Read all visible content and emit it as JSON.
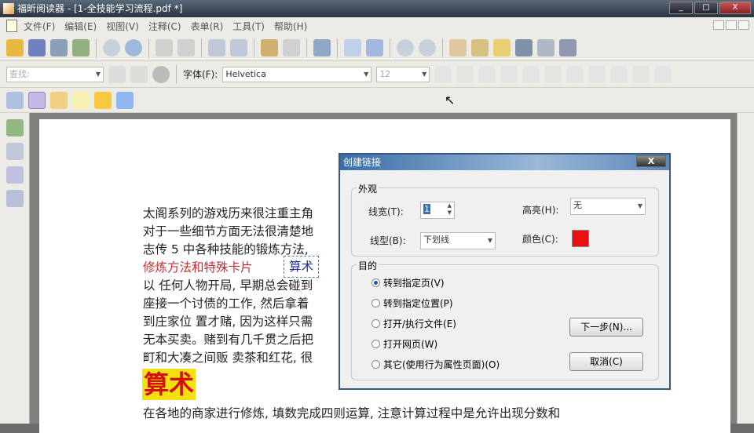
{
  "window": {
    "title": "福昕阅读器 - [1-全技能学习流程.pdf *]"
  },
  "menu": [
    "文件(F)",
    "编辑(E)",
    "视图(V)",
    "注释(C)",
    "表单(R)",
    "工具(T)",
    "帮助(H)"
  ],
  "toolbar2": {
    "search_placeholder": "查找:",
    "font_label": "字体(F):",
    "font_value": "Helvetica",
    "size_value": "12"
  },
  "document": {
    "lines": [
      "太阁系列的游戏历来很注重主角",
      "对于一些细节方面无法很清楚地",
      "志传 5 中各种技能的锻炼方法,"
    ],
    "red_line": "修炼方法和特殊卡片",
    "annotation": "算术",
    "lines2": [
      "以 任何人物开局, 早期总会碰到",
      "座接一个讨债的工作, 然后拿着",
      "到庄家位 置才赌, 因为这样只需",
      "无本买卖。赌到有几千贯之后把",
      "町和大凑之间贩 卖茶和红花, 很"
    ],
    "heading": "算术",
    "last_line": "在各地的商家进行修炼, 填数完成四则运算, 注意计算过程中是允许出现分数和"
  },
  "dialog": {
    "title": "创建链接",
    "close": "X",
    "appearance": "外观",
    "line_width_label": "线宽(T):",
    "line_width_value": "1",
    "highlight_label": "高亮(H):",
    "highlight_value": "无",
    "line_style_label": "线型(B):",
    "line_style_value": "下划线",
    "color_label": "颜色(C):",
    "color": "#ee1010",
    "destination": "目的",
    "options": [
      {
        "label": "转到指定页(V)",
        "checked": true
      },
      {
        "label": "转到指定位置(P)",
        "checked": false
      },
      {
        "label": "打开/执行文件(E)",
        "checked": false
      },
      {
        "label": "打开网页(W)",
        "checked": false
      },
      {
        "label": "其它(使用行为属性页面)(O)",
        "checked": false
      }
    ],
    "next_button": "下一步(N)...",
    "cancel_button": "取消(C)"
  }
}
